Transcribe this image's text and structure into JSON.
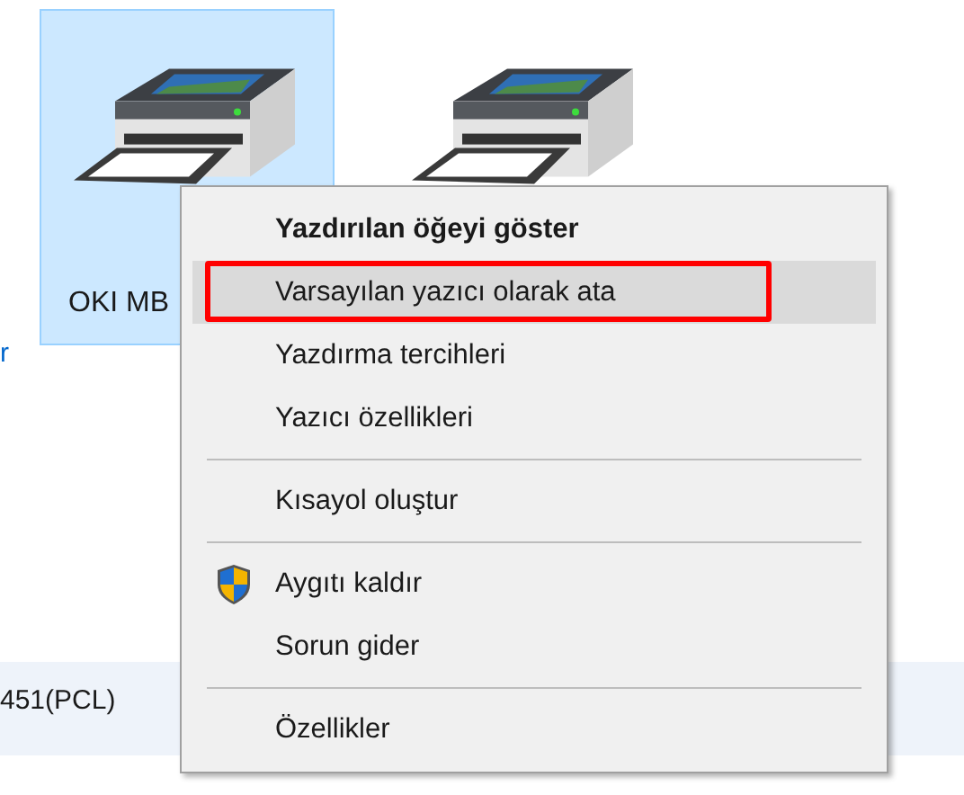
{
  "devices": [
    {
      "label": "OKI MB",
      "selected": true
    },
    {
      "selected": false
    }
  ],
  "side_link": "r",
  "status_bar": {
    "text": "451(PCL)"
  },
  "context_menu": {
    "items": [
      {
        "kind": "item",
        "label": "Yazdırılan öğeyi göster",
        "bold": true,
        "selected": false,
        "outlined": false
      },
      {
        "kind": "item",
        "label": "Varsayılan yazıcı olarak ata",
        "bold": false,
        "selected": true,
        "outlined": true
      },
      {
        "kind": "item",
        "label": "Yazdırma tercihleri",
        "bold": false,
        "selected": false,
        "outlined": false
      },
      {
        "kind": "item",
        "label": "Yazıcı özellikleri",
        "bold": false,
        "selected": false,
        "outlined": false
      },
      {
        "kind": "separator"
      },
      {
        "kind": "item",
        "label": "Kısayol oluştur",
        "bold": false,
        "selected": false,
        "outlined": false
      },
      {
        "kind": "separator"
      },
      {
        "kind": "item",
        "label": "Aygıtı kaldır",
        "bold": false,
        "selected": false,
        "outlined": false,
        "shield": true
      },
      {
        "kind": "item",
        "label": "Sorun gider",
        "bold": false,
        "selected": false,
        "outlined": false
      },
      {
        "kind": "separator"
      },
      {
        "kind": "item",
        "label": "Özellikler",
        "bold": false,
        "selected": false,
        "outlined": false
      }
    ]
  }
}
